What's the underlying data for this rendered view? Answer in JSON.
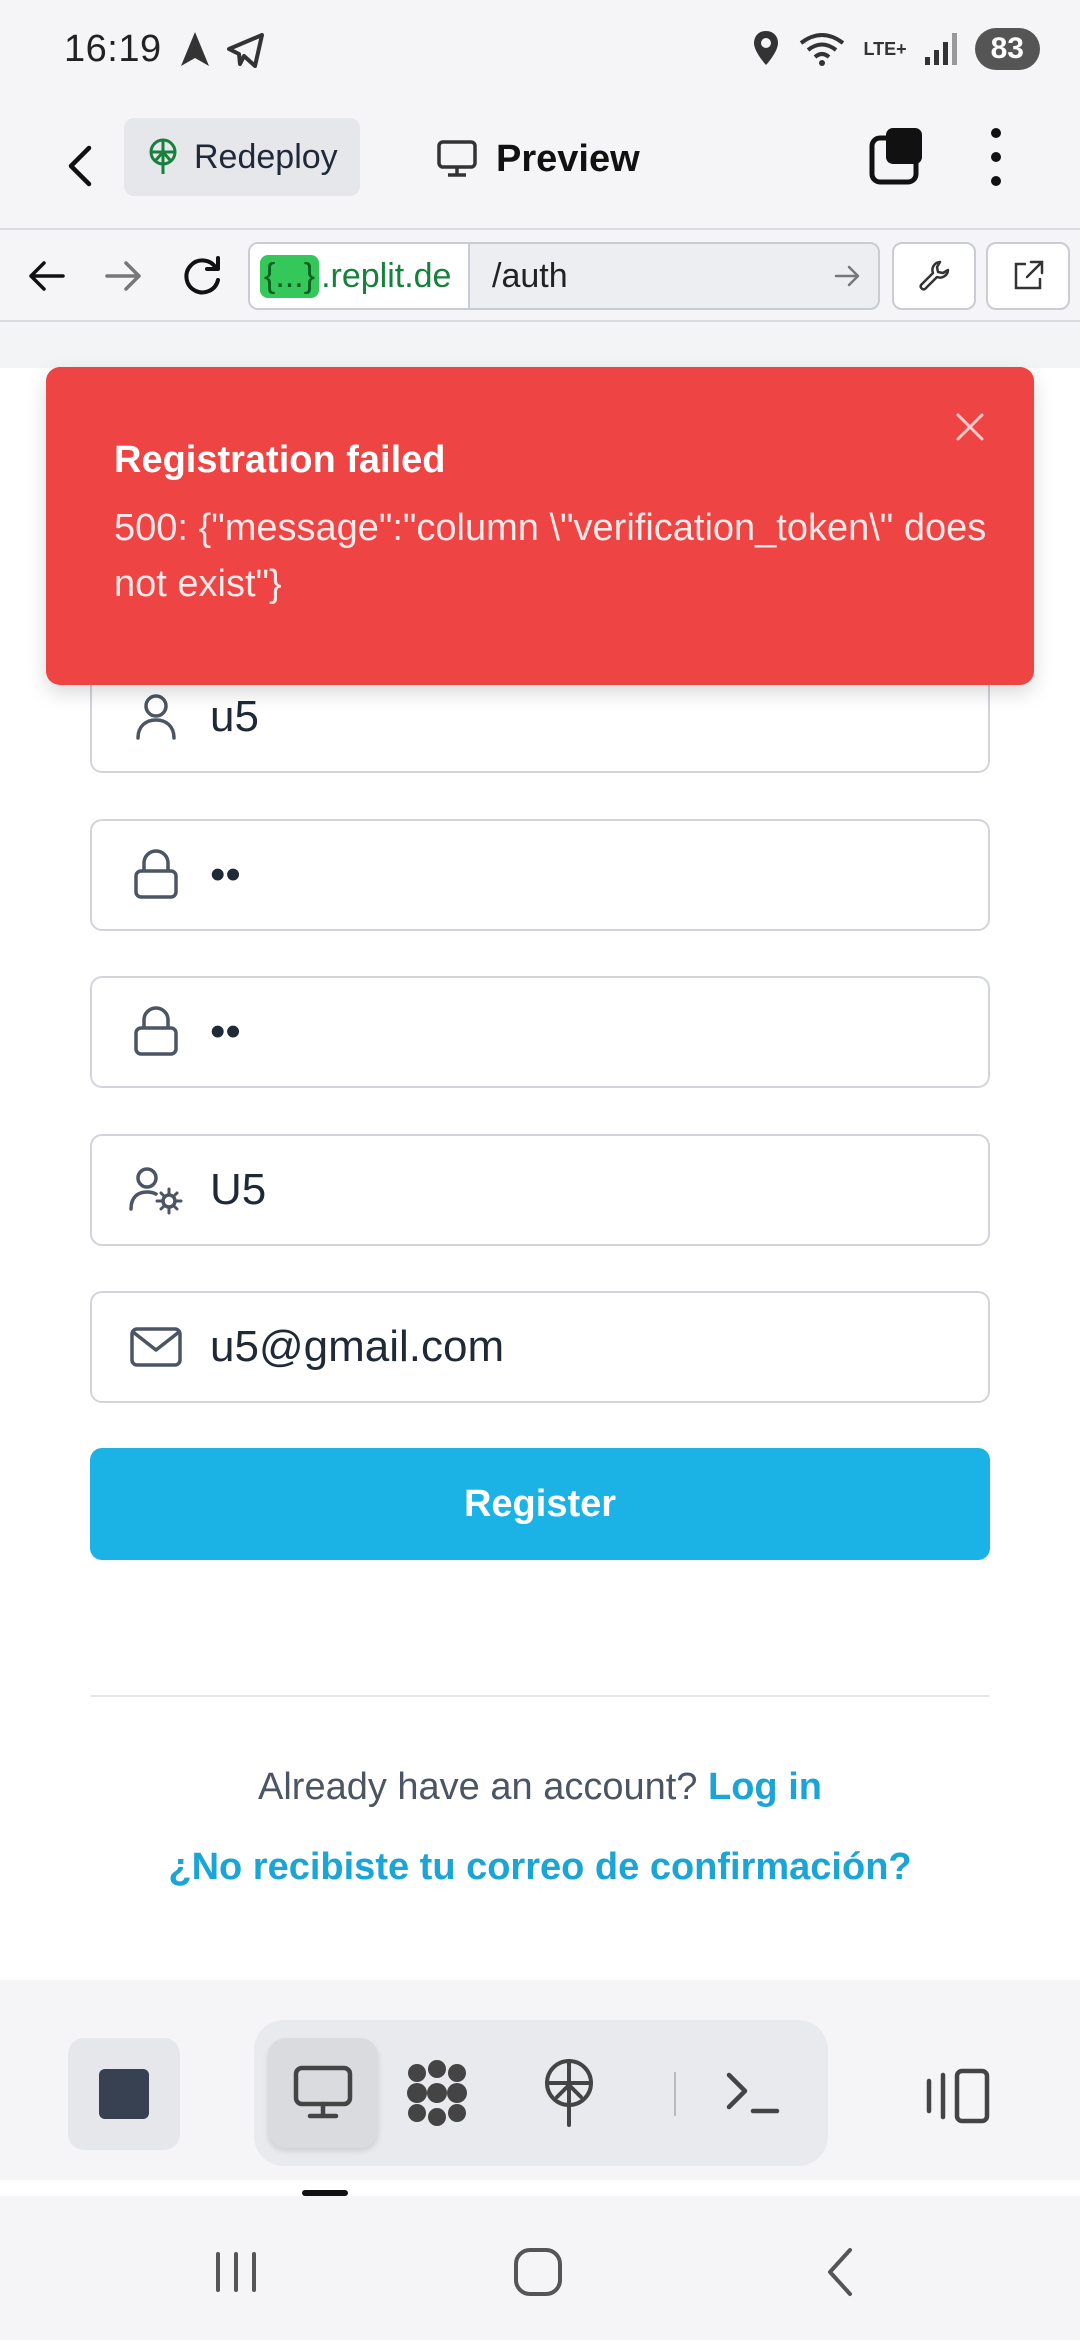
{
  "status_bar": {
    "time": "16:19",
    "battery": "83",
    "network": "LTE+"
  },
  "header": {
    "redeploy_label": "Redeploy",
    "title": "Preview"
  },
  "url_bar": {
    "domain_token": "{...}",
    "domain_suffix": ".replit.de",
    "path": "/auth"
  },
  "toast": {
    "title": "Registration failed",
    "message": "500: {\"message\":\"column \\\"verification_token\\\" does not exist\"}"
  },
  "form": {
    "username": "u5",
    "password": "••",
    "confirm_password": "••",
    "display_name": "U5",
    "email": "u5@gmail.com",
    "register_label": "Register"
  },
  "footer": {
    "already_text": "Already have an account?",
    "login_link": "Log in",
    "resend_link": "¿No recibiste tu correo de confirmación?"
  },
  "colors": {
    "accent": "#1bb3e6",
    "error": "#ef4444",
    "link": "#1aa5d6"
  }
}
